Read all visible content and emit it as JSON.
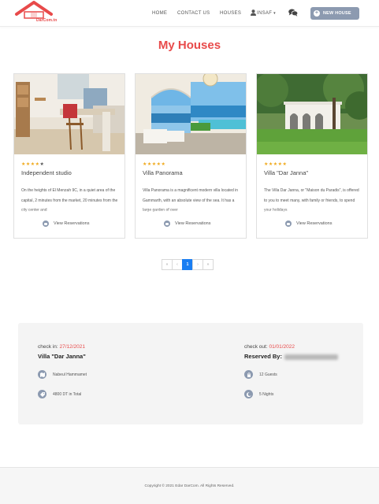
{
  "brand": {
    "logo_text": "DarCom.tn",
    "accent_color": "#e84a4a"
  },
  "nav": {
    "links": [
      "HOME",
      "CONTACT US",
      "HOUSES"
    ],
    "user_label": "INSAF",
    "user_icon": "user-icon",
    "chat_icon": "comments-icon",
    "new_house_label": "NEW HOUSE",
    "new_house_color": "#8c9ab0"
  },
  "page_title": "My Houses",
  "cards": [
    {
      "stars": "★★★★",
      "stars_empty": "★",
      "rating": 4,
      "title": "Independent studio",
      "description": "On the heights of El Menzah 9C, in a quiet area of the capital, 2 minutes from the market, 20 minutes from the city center and",
      "link_label": "View Reservations"
    },
    {
      "stars": "★★★★★",
      "stars_empty": "",
      "rating": 5,
      "title": "Villa Panorama",
      "description": "Villa Panorama is a magnificent modern villa located in Gammarth, with an absolute view of the sea. It has a large garden of over",
      "link_label": "View Reservations"
    },
    {
      "stars": "★★★★★",
      "stars_empty": "",
      "rating": 5,
      "title": "Villa \"Dar Janna\"",
      "description": "The Villa Dar Janna, or \"Maison du Paradis\", is offered to you to meet many, with family or friends, to spend your holidays",
      "link_label": "View Reservations"
    }
  ],
  "pagination": {
    "first": "«",
    "prev": "‹",
    "current": "1",
    "next": "›",
    "last": "»"
  },
  "reservation": {
    "checkin_label": "check in:",
    "checkin_date": "27/12/2021",
    "checkout_label": "check out:",
    "checkout_date": "01/01/2022",
    "house_name": "Villa \"Dar Janna\"",
    "reserved_by_label": "Reserved By:",
    "location": "Nabeul Hammamet",
    "guests": "12 Guests",
    "price": "4800 DT in Total",
    "nights": "5 Nights"
  },
  "footer": {
    "copyright": "Copyright © 2021 Edar DarCom. All Rights Reserved."
  }
}
